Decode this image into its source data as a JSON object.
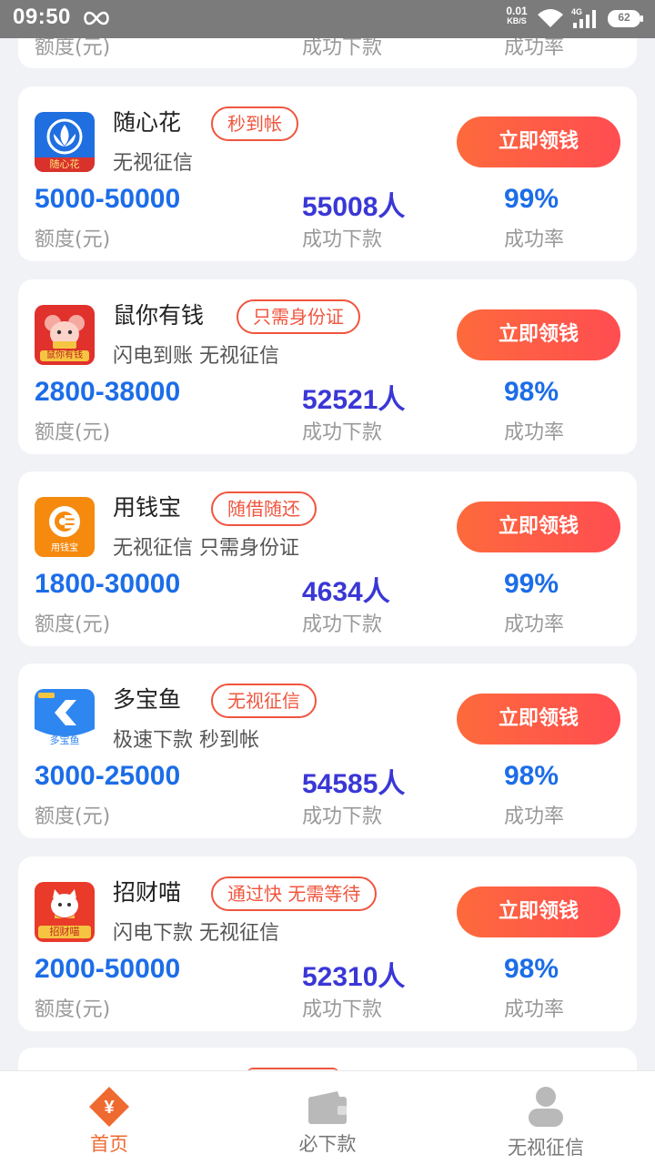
{
  "status_bar": {
    "time": "09:50",
    "net_speed": "0.01",
    "net_unit": "KB/S",
    "network_type": "4G",
    "battery": "62"
  },
  "partial_top_card": {
    "range_label": "额度(元)",
    "count_label": "成功下款",
    "rate_label": "成功率"
  },
  "loans": [
    {
      "name": "随心花",
      "tag": "秒到帐",
      "desc": "无视征信",
      "button": "立即领钱",
      "range": "5000-50000",
      "range_label": "额度(元)",
      "count": "55008人",
      "count_label": "成功下款",
      "rate": "99%",
      "rate_label": "成功率",
      "logo_caption": "随心花",
      "logo_color": "#1f6fe0"
    },
    {
      "name": "鼠你有钱",
      "tag": "只需身份证",
      "desc": "闪电到账 无视征信",
      "button": "立即领钱",
      "range": "2800-38000",
      "range_label": "额度(元)",
      "count": "52521人",
      "count_label": "成功下款",
      "rate": "98%",
      "rate_label": "成功率",
      "logo_caption": "鼠你有钱",
      "logo_color": "#e0312d"
    },
    {
      "name": "用钱宝",
      "tag": "随借随还",
      "desc": "无视征信 只需身份证",
      "button": "立即领钱",
      "range": "1800-30000",
      "range_label": "额度(元)",
      "count": "4634人",
      "count_label": "成功下款",
      "rate": "99%",
      "rate_label": "成功率",
      "logo_caption": "用钱宝",
      "logo_color": "#f58a0f"
    },
    {
      "name": "多宝鱼",
      "tag": "无视征信",
      "desc": "极速下款 秒到帐",
      "button": "立即领钱",
      "range": "3000-25000",
      "range_label": "额度(元)",
      "count": "54585人",
      "count_label": "成功下款",
      "rate": "98%",
      "rate_label": "成功率",
      "logo_caption": "多宝鱼",
      "logo_color": "#2e86f0"
    },
    {
      "name": "招财喵",
      "tag": "通过快 无需等待",
      "desc": "闪电下款 无视征信",
      "button": "立即领钱",
      "range": "2000-50000",
      "range_label": "额度(元)",
      "count": "52310人",
      "count_label": "成功下款",
      "rate": "98%",
      "rate_label": "成功率",
      "logo_caption": "招财喵",
      "logo_color": "#e93a2a"
    }
  ],
  "bottom_nav": [
    {
      "label": "首页",
      "icon": "home-yuan-icon",
      "active": true
    },
    {
      "label": "必下款",
      "icon": "wallet-icon",
      "active": false
    },
    {
      "label": "无视征信",
      "icon": "user-icon",
      "active": false
    }
  ],
  "colors": {
    "accent": "#f0553e",
    "range_blue": "#1c6de8",
    "count_indigo": "#3a37d6",
    "nav_active": "#ef6a30",
    "nav_inactive": "#9a9a9a"
  }
}
